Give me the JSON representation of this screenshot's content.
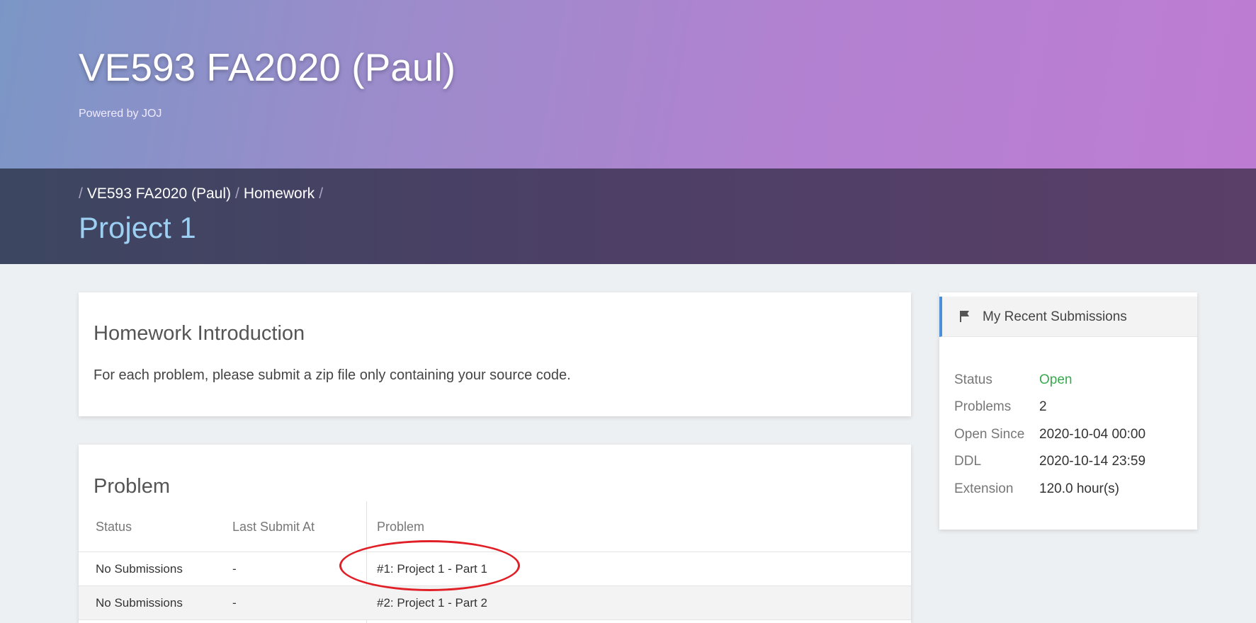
{
  "header": {
    "title": "VE593 FA2020 (Paul)",
    "subtitle": "Powered by JOJ"
  },
  "breadcrumb": {
    "items": [
      "VE593 FA2020 (Paul)",
      "Homework"
    ],
    "separator": "/"
  },
  "page_title": "Project 1",
  "intro": {
    "title": "Homework Introduction",
    "text": "For each problem, please submit a zip file only containing your source code."
  },
  "problem_section": {
    "title": "Problem",
    "columns": [
      "Status",
      "Last Submit At",
      "Problem"
    ],
    "rows": [
      {
        "status": "No Submissions",
        "last_submit": "-",
        "problem": "#1: Project 1 - Part 1"
      },
      {
        "status": "No Submissions",
        "last_submit": "-",
        "problem": "#2: Project 1 - Part 2"
      }
    ]
  },
  "sidebar": {
    "header_label": "My Recent Submissions",
    "header_icon": "flag-icon",
    "accent_color": "#4a90d9",
    "stats": [
      {
        "label": "Status",
        "value": "Open"
      },
      {
        "label": "Problems",
        "value": "2"
      },
      {
        "label": "Open Since",
        "value": "2020-10-04 00:00"
      },
      {
        "label": "DDL",
        "value": "2020-10-14 23:59"
      },
      {
        "label": "Extension",
        "value": "120.0 hour(s)"
      }
    ],
    "open_color": "#39a950"
  },
  "annotation_color": "#e01f26"
}
